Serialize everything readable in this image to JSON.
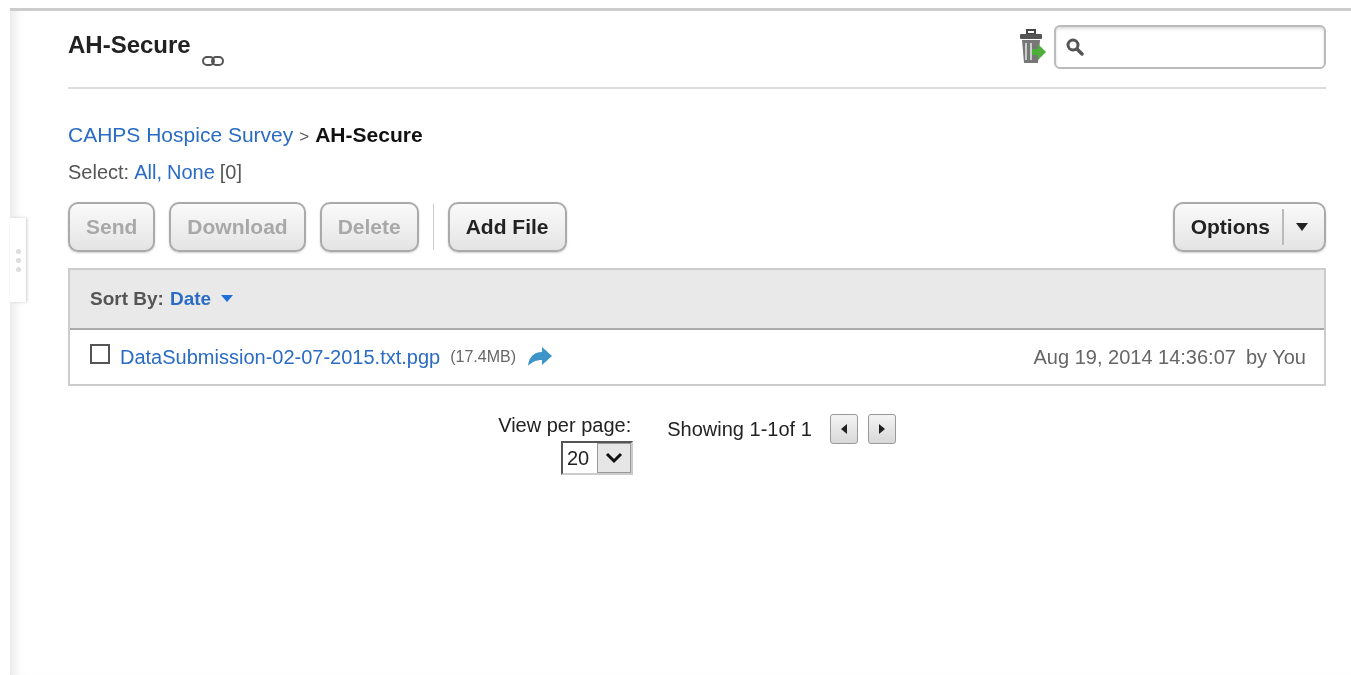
{
  "header": {
    "title": "AH-Secure"
  },
  "breadcrumb": {
    "parent": "CAHPS Hospice Survey",
    "separator": ">",
    "current": "AH-Secure"
  },
  "select": {
    "label": "Select:",
    "all": "All",
    "separator": ",",
    "none": "None",
    "count": "[0]"
  },
  "toolbar": {
    "buttons": [
      {
        "label": "Send",
        "disabled": true
      },
      {
        "label": "Download",
        "disabled": true
      },
      {
        "label": "Delete",
        "disabled": true
      },
      {
        "label": "Add File",
        "disabled": false
      }
    ],
    "options": "Options"
  },
  "sort": {
    "label": "Sort By:",
    "value": "Date"
  },
  "files": [
    {
      "name": "DataSubmission-02-07-2015.txt.pgp",
      "size": "(17.4MB)",
      "checked": false,
      "date": "Aug 19, 2014 14:36:07",
      "owner": "by You"
    }
  ],
  "pagination": {
    "per_page_label": "View per page:",
    "per_page": "20",
    "showing": "Showing 1-1of 1"
  }
}
